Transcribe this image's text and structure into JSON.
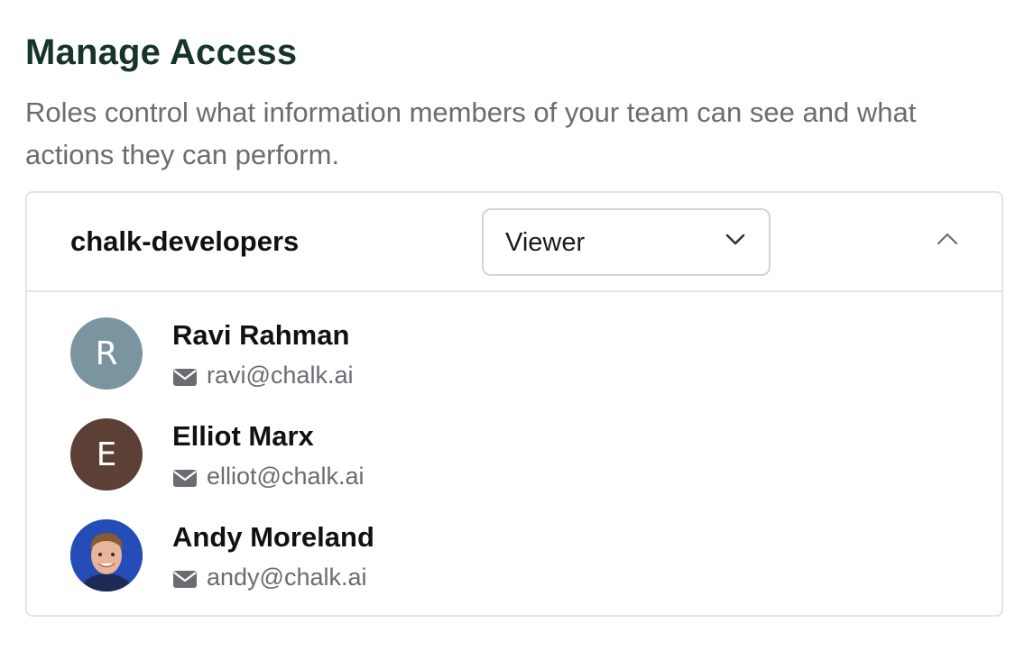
{
  "page": {
    "title": "Manage Access",
    "description": "Roles control what information members of your team can see and what actions they can perform."
  },
  "group": {
    "name": "chalk-developers",
    "role_selected": "Viewer",
    "expanded": true,
    "icons": {
      "dropdown": "chevron-down-icon",
      "toggle": "chevron-up-icon"
    }
  },
  "members": [
    {
      "name": "Ravi Rahman",
      "email": "ravi@chalk.ai",
      "avatar_initial": "R",
      "avatar_color": "#7b95a0",
      "avatar_type": "initial"
    },
    {
      "name": "Elliot Marx",
      "email": "elliot@chalk.ai",
      "avatar_initial": "E",
      "avatar_color": "#5c3f35",
      "avatar_type": "initial"
    },
    {
      "name": "Andy Moreland",
      "email": "andy@chalk.ai",
      "avatar_type": "photo",
      "avatar_color": "#2a56c6"
    }
  ],
  "colors": {
    "title": "#17342a",
    "muted_text": "#6b6b72",
    "border": "#e4e4e7"
  }
}
